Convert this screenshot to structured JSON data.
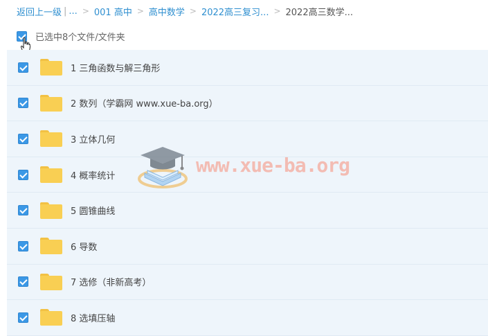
{
  "breadcrumb": {
    "back": "返回上一级",
    "divider": "|",
    "ellipsis": "...",
    "items": [
      "001 高中",
      "高中数学",
      "2022高三复习...",
      "2022高三数学..."
    ]
  },
  "selection": {
    "status": "已选中8个文件/文件夹"
  },
  "files": [
    {
      "name": "1 三角函数与解三角形"
    },
    {
      "name": "2 数列（学霸网 www.xue-ba.org）"
    },
    {
      "name": "3 立体几何"
    },
    {
      "name": "4 概率统计"
    },
    {
      "name": "5 圆锥曲线"
    },
    {
      "name": "6 导数"
    },
    {
      "name": "7 选修（非新高考）"
    },
    {
      "name": "8 选填压轴"
    }
  ],
  "watermark": {
    "text": "www.xue-ba.org"
  },
  "colors": {
    "link": "#2f8fd0",
    "checkbox": "#3b98e6",
    "row_bg": "#eef5fb",
    "folder": "#f9cf53",
    "watermark": "#f5a99b"
  }
}
